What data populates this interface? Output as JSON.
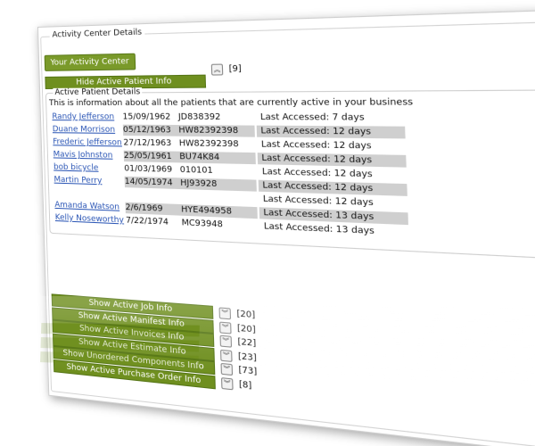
{
  "panel": {
    "legend": "Activity Center Details",
    "your_activity_center": "Your Activity Center"
  },
  "active_patient": {
    "button_label": "Hide Active Patient Info",
    "count": "[9]",
    "details_legend": "Active Patient Details",
    "info_text": "This is information about all the patients that are currently active in your business",
    "rows": [
      {
        "name": "Randy Jefferson",
        "dob": "15/09/1962",
        "id": "JD838392",
        "accessed": "Last Accessed: 7 days",
        "shaded": false
      },
      {
        "name": "Duane Morrison",
        "dob": "05/12/1963",
        "id": "HW82392398",
        "accessed": "Last Accessed: 12 days",
        "shaded": true
      },
      {
        "name": "Frederic Jefferson",
        "dob": "27/12/1963",
        "id": "HW82392398",
        "accessed": "Last Accessed: 12 days",
        "shaded": false
      },
      {
        "name": "Mavis Johnston",
        "dob": "25/05/1961",
        "id": "BU74K84",
        "accessed": "Last Accessed: 12 days",
        "shaded": true
      },
      {
        "name": "bob bicycle",
        "dob": "01/03/1969",
        "id": "010101",
        "accessed": "Last Accessed: 12 days",
        "shaded": false
      },
      {
        "name": "Martin Perry",
        "dob": "14/05/1974",
        "id": "HJ93928",
        "accessed": "Last Accessed: 12 days",
        "shaded": true
      },
      {
        "name": "",
        "dob": "",
        "id": "",
        "accessed": "Last Accessed: 12 days",
        "shaded": false
      },
      {
        "name": "Amanda Watson",
        "dob": "2/6/1969",
        "id": "HYE494958",
        "accessed": "Last Accessed: 13 days",
        "shaded": true
      },
      {
        "name": "Kelly Noseworthy",
        "dob": "7/22/1974",
        "id": "MC93948",
        "accessed": "Last Accessed: 13 days",
        "shaded": false
      }
    ]
  },
  "sections": [
    {
      "label": "Show Active Job Info",
      "count": "[20]"
    },
    {
      "label": "Show Active Manifest Info",
      "count": "[20]"
    },
    {
      "label": "Show Active Invoices Info",
      "count": "[22]"
    },
    {
      "label": "Show Active Estimate Info",
      "count": "[23]"
    },
    {
      "label": "Show Unordered Components Info",
      "count": "[73]"
    },
    {
      "label": "Show Active Purchase Order Info",
      "count": "[8]"
    }
  ],
  "icons": {
    "collapse": "chevron-up-icon",
    "expand": "chevron-down-icon"
  },
  "colors": {
    "button_green": "#6f8f1f",
    "link_blue": "#2a55b5",
    "row_shade": "#cfcfcf"
  }
}
